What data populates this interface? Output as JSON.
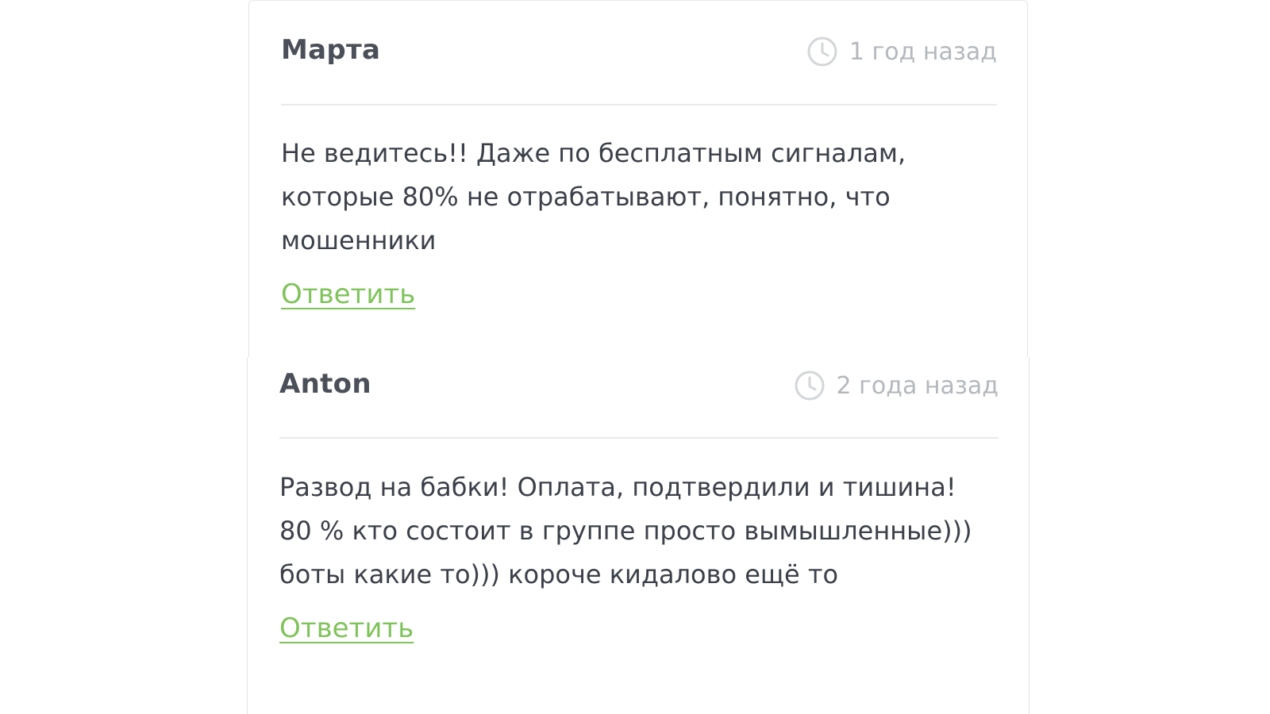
{
  "comments": [
    {
      "author": "Марта",
      "time": "1 год назад",
      "lines": [
        "Не ведитесь!! Даже по бесплатным сигналам,",
        "которые 80% не отрабатывают, понятно, что",
        "мошенники"
      ],
      "reply_label": "Ответить"
    },
    {
      "author": "Anton",
      "time": "2 года назад",
      "lines": [
        "Развод на бабки! Оплата, подтвердили и тишина!",
        "80 % кто состоит в группе просто вымышленные)))",
        "боты какие то))) короче кидалово ещё то"
      ],
      "reply_label": "Ответить"
    }
  ],
  "icons": {
    "time": "clock-icon"
  },
  "colors": {
    "author": "#4b4f58",
    "meta": "#b4b8bd",
    "text": "#3c4049",
    "link": "#7fc35a",
    "divider": "#e9e9e9"
  }
}
